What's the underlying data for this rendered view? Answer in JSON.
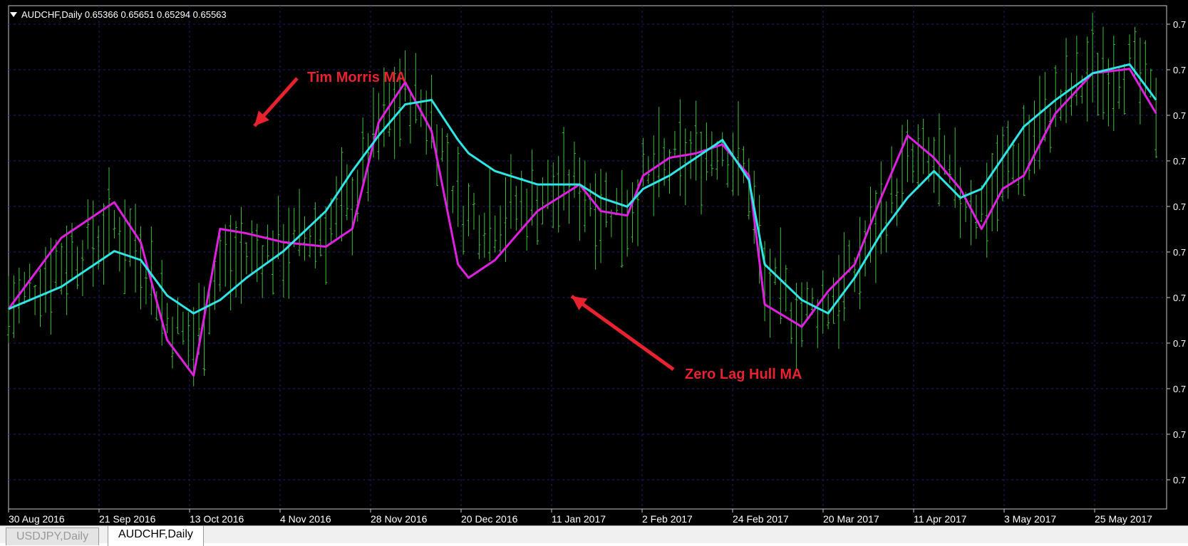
{
  "window": {
    "symbol_header": "AUDCHF,Daily  0.65366 0.65651 0.65294 0.65563"
  },
  "tabs": [
    {
      "label": "USDJPY,Daily",
      "active": false
    },
    {
      "label": "AUDCHF,Daily",
      "active": true
    }
  ],
  "annotations": {
    "tim_morris": "Tim Morris MA",
    "zero_lag": "Zero Lag Hull MA"
  },
  "colors": {
    "background": "#000000",
    "bars": "#3fbf3f",
    "tim_morris_ma": "#e020e0",
    "zero_lag_hull_ma": "#2ee6e6",
    "annotation": "#e8222e",
    "grid": "#1c1c6e",
    "text": "#ffffff"
  },
  "chart_data": {
    "type": "line",
    "title": "AUDCHF,Daily",
    "ohlc_last": {
      "open": 0.65366,
      "high": 0.65651,
      "low": 0.65294,
      "close": 0.65563
    },
    "x_tick_labels": [
      "30 Aug 2016",
      "21 Sep 2016",
      "13 Oct 2016",
      "4 Nov 2016",
      "28 Nov 2016",
      "20 Dec 2016",
      "11 Jan 2017",
      "2 Feb 2017",
      "24 Feb 2017",
      "20 Mar 2017",
      "11 Apr 2017",
      "3 May 2017",
      "25 May 2017"
    ],
    "y_tick_labels": [
      "0.7",
      "0.7",
      "0.7",
      "0.7",
      "0.7",
      "0.7",
      "0.7",
      "0.7",
      "0.7",
      "0.7",
      "0.7"
    ],
    "grid": true,
    "series": [
      {
        "name": "Tim Morris MA",
        "x": [
          0,
          10,
          20,
          25,
          30,
          35,
          40,
          45,
          52,
          60,
          65,
          70,
          75,
          80,
          85,
          87,
          92,
          100,
          108,
          112,
          117,
          120,
          125,
          130,
          135,
          140,
          143,
          150,
          155,
          160,
          165,
          170,
          175,
          180,
          184,
          188,
          192,
          198,
          205,
          212,
          217
        ],
        "values": [
          45,
          61,
          69,
          60,
          38,
          30,
          63,
          62,
          60,
          59,
          63,
          87,
          96,
          85,
          55,
          52,
          56,
          67,
          73,
          67,
          66,
          75,
          79,
          80,
          82,
          75,
          46,
          41,
          49,
          55,
          70,
          84,
          79,
          72,
          63,
          72,
          75,
          89,
          98,
          99,
          89
        ]
      },
      {
        "name": "Zero Lag Hull MA",
        "x": [
          0,
          10,
          20,
          25,
          30,
          35,
          40,
          45,
          52,
          60,
          65,
          70,
          75,
          80,
          85,
          87,
          92,
          100,
          108,
          112,
          117,
          120,
          125,
          130,
          135,
          140,
          143,
          150,
          155,
          160,
          165,
          170,
          175,
          180,
          184,
          188,
          192,
          198,
          205,
          212,
          217
        ],
        "values": [
          45,
          50,
          58,
          56,
          48,
          44,
          47,
          52,
          58,
          67,
          76,
          84,
          91,
          92,
          83,
          80,
          76,
          73,
          73,
          70,
          68,
          72,
          75,
          79,
          83,
          74,
          55,
          47,
          44,
          52,
          62,
          70,
          76,
          70,
          72,
          79,
          86,
          92,
          98,
          100,
          92
        ]
      }
    ]
  }
}
